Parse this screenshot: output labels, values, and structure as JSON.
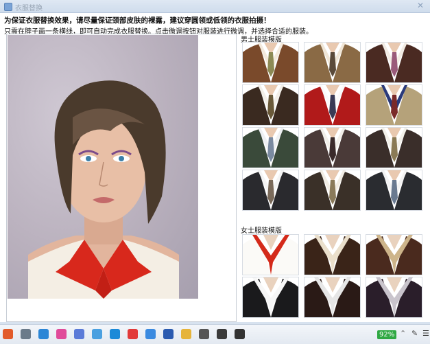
{
  "window": {
    "title": "衣服替换"
  },
  "notice": "为保证衣服替换效果，请尽量保证颈部皮肤的裸露，建议穿圆领或低领的衣服拍摄！",
  "hint": "只需在脖子画一条横线，即可自动完成衣服替换。点击微调按钮对服装进行微调，并选择合适的服装。",
  "sections": {
    "male_label": "男士服装模版",
    "female_label": "女士服装模版"
  },
  "male_templates": [
    {
      "suit": "#7a4a2b",
      "shirt": "#f3e9dc",
      "tie": "#8c8a55"
    },
    {
      "suit": "#8a6a45",
      "shirt": "#f0e6d6",
      "tie": "#5a4a3a"
    },
    {
      "suit": "#4a2a22",
      "shirt": "#f2ece4",
      "tie": "#9a5a7a"
    },
    {
      "suit": "#3a2a20",
      "shirt": "#f3efe8",
      "tie": "#6a5a3a"
    },
    {
      "suit": "#b11a1a",
      "shirt": "#fafafa",
      "tie": "#3a3a55"
    },
    {
      "suit": "#b5a27a",
      "shirt": "#2a3a7a",
      "tie": "#7a2a2a"
    },
    {
      "suit": "#3a4a3a",
      "shirt": "#eef0f2",
      "tie": "#7a8aa0"
    },
    {
      "suit": "#4a3a38",
      "shirt": "#f2efe9",
      "tie": "#3a2a2a"
    },
    {
      "suit": "#3a2e2a",
      "shirt": "#f3f1ea",
      "tie": "#8a7a55"
    },
    {
      "suit": "#2a2a2e",
      "shirt": "#f4f4f4",
      "tie": "#7a6a5a"
    },
    {
      "suit": "#3a3028",
      "shirt": "#f2ede4",
      "tie": "#8a7a5a"
    },
    {
      "suit": "#2a2c30",
      "shirt": "#f3f3f3",
      "tie": "#6a7a90"
    }
  ],
  "female_templates": [
    {
      "suit": "#fbfaf7",
      "shirt": "#d42a1a",
      "tie": "#d42a1a"
    },
    {
      "suit": "#3a2418",
      "shirt": "#eadfcb",
      "tie": "#eadfcb"
    },
    {
      "suit": "#4a2a1e",
      "shirt": "#cdb48a",
      "tie": "#cdb48a"
    },
    {
      "suit": "#1a1a1c",
      "shirt": "#f7f7f7",
      "tie": "#f7f7f7"
    },
    {
      "suit": "#2a1a16",
      "shirt": "#e6e6e6",
      "tie": "#b02020"
    },
    {
      "suit": "#2a1e2a",
      "shirt": "#c9c4cc",
      "tie": "#c9c4cc"
    }
  ],
  "photo": {
    "blouse_color": "#f4eee4",
    "collar_color": "#d8281c"
  },
  "taskbar": {
    "icons": [
      {
        "name": "browser-icon",
        "color": "#e25b2a"
      },
      {
        "name": "settings-icon",
        "color": "#6b7b8a"
      },
      {
        "name": "edge-icon",
        "color": "#2b86d6"
      },
      {
        "name": "pinwheel-icon",
        "color": "#e04a9a"
      },
      {
        "name": "feather-icon",
        "color": "#5b7bd8"
      },
      {
        "name": "mail-icon",
        "color": "#4aa0e0"
      },
      {
        "name": "clock-icon",
        "color": "#1b8ad8"
      },
      {
        "name": "weibo-icon",
        "color": "#e23a3a"
      },
      {
        "name": "chat-icon",
        "color": "#3a8ae0"
      },
      {
        "name": "word-icon",
        "color": "#2b5bb0"
      },
      {
        "name": "folder-icon",
        "color": "#e6b43a"
      },
      {
        "name": "camera-icon",
        "color": "#555555"
      },
      {
        "name": "photo-icon",
        "color": "#3a3a3a"
      },
      {
        "name": "gear-icon",
        "color": "#333333"
      }
    ],
    "battery_text": "92%"
  }
}
